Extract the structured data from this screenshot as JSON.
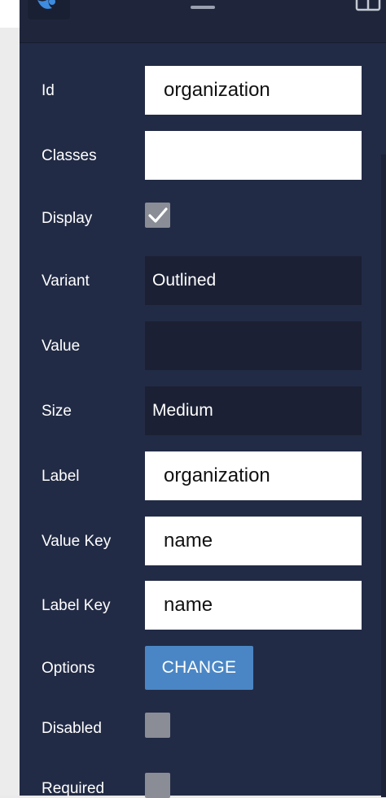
{
  "form": {
    "id": {
      "label": "Id",
      "value": "organization"
    },
    "classes": {
      "label": "Classes",
      "value": ""
    },
    "display": {
      "label": "Display",
      "checked": true
    },
    "variant": {
      "label": "Variant",
      "value": "Outlined"
    },
    "value": {
      "label": "Value",
      "value": ""
    },
    "size": {
      "label": "Size",
      "value": "Medium"
    },
    "label": {
      "label": "Label",
      "value": "organization"
    },
    "value_key": {
      "label": "Value Key",
      "value": "name"
    },
    "label_key": {
      "label": "Label Key",
      "value": "name"
    },
    "options": {
      "label": "Options",
      "button_label": "CHANGE"
    },
    "disabled": {
      "label": "Disabled",
      "checked": false
    },
    "required": {
      "label": "Required",
      "checked": false
    }
  },
  "colors": {
    "panel_bg": "#222b45",
    "dark_field_bg": "#1b2034",
    "button_bg": "#4a86c5",
    "checkbox_bg": "#8a8d96"
  },
  "icons": {
    "logo": "brand-logo-icon",
    "drag": "drag-handle-icon",
    "layout": "layout-icon",
    "check": "checkmark-icon"
  }
}
